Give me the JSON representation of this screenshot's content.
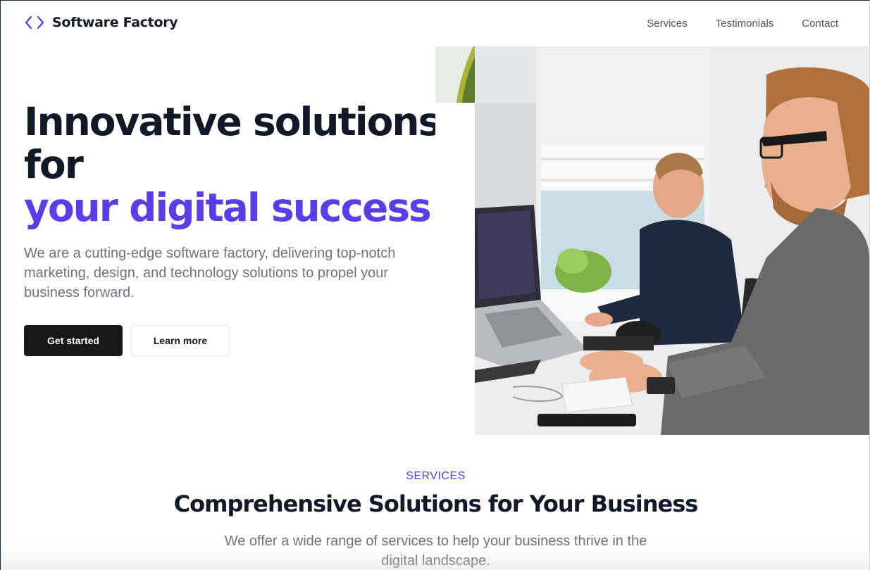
{
  "brand": {
    "name": "Software Factory",
    "icon": "code-brackets-icon",
    "accent_color": "#5b3ce6"
  },
  "nav": {
    "items": [
      {
        "label": "Services"
      },
      {
        "label": "Testimonials"
      },
      {
        "label": "Contact"
      }
    ]
  },
  "hero": {
    "title_line1": "Innovative solutions",
    "title_line2": "for",
    "title_accent": "your digital success",
    "description": "We are a cutting-edge software factory, delivering top-notch marketing, design, and technology solutions to propel your business forward.",
    "primary_button": "Get started",
    "secondary_button": "Learn more"
  },
  "services": {
    "eyebrow": "SERVICES",
    "title": "Comprehensive Solutions for Your Business",
    "description": "We offer a wide range of services to help your business thrive in the digital landscape."
  },
  "colors": {
    "accent": "#5b3ce6",
    "text": "#111827",
    "muted": "#6b7280",
    "button_dark": "#18181b"
  }
}
